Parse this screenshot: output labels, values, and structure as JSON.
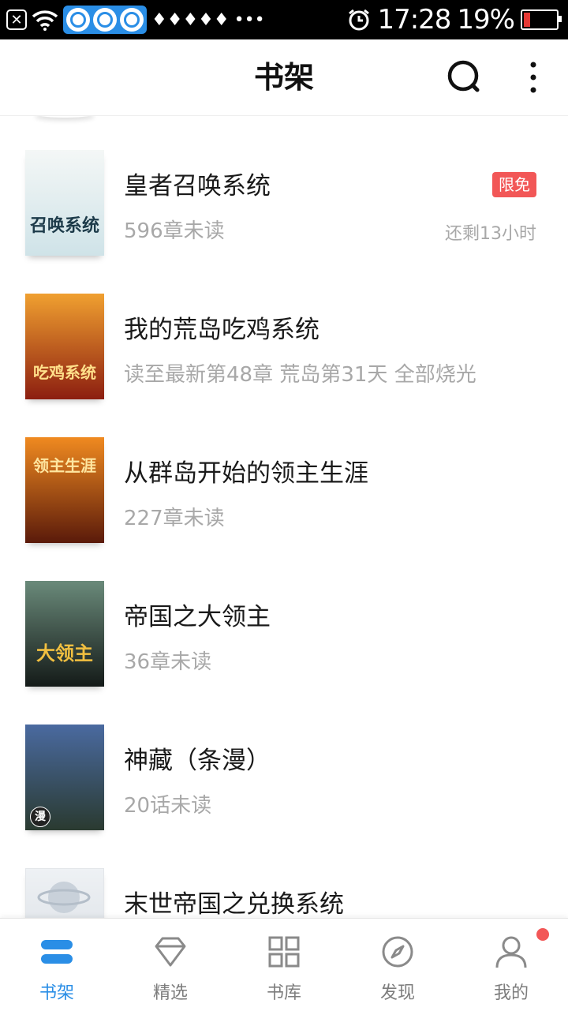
{
  "status_bar": {
    "time": "17:28",
    "battery_percent": "19%",
    "battery_level": 0.19,
    "signal_glyphs": "♦♦♦♦♦",
    "more": "•••"
  },
  "app_bar": {
    "title": "书架",
    "search_icon": "search-icon",
    "more_icon": "more-vertical-icon"
  },
  "books": [
    {
      "title": "皇者召唤系统",
      "subtitle": "596章未读",
      "badge": "限免",
      "remaining": "还剩13小时",
      "cover_text": "召唤系统",
      "cover_colors": [
        "#f4f7f6",
        "#cfe3e8"
      ],
      "cover_text_color": "#1d3b4a"
    },
    {
      "title": "我的荒岛吃鸡系统",
      "subtitle": "读至最新第48章 荒岛第31天 全部烧光",
      "cover_text": "吃鸡系统",
      "cover_colors": [
        "#f0a030",
        "#8c1e10"
      ],
      "cover_text_color": "#ffe08a"
    },
    {
      "title": "从群岛开始的领主生涯",
      "subtitle": "227章未读",
      "cover_text": "领主生涯",
      "cover_colors": [
        "#f08a20",
        "#5a1a0a"
      ],
      "cover_text_color": "#ffe6a0"
    },
    {
      "title": "帝国之大领主",
      "subtitle": "36章未读",
      "cover_text": "大领主",
      "cover_colors": [
        "#6a8a7a",
        "#141a18"
      ],
      "cover_text_color": "#f2c040"
    },
    {
      "title": "神藏（条漫）",
      "subtitle": "20话未读",
      "cover_text": "漫",
      "cover_colors": [
        "#4a6aa0",
        "#2a3a30"
      ],
      "cover_text_color": "#ffffff"
    },
    {
      "title": "末世帝国之兑换系统",
      "subtitle": "",
      "cover_text": "",
      "cover_colors": [
        "#eef1f4",
        "#d9dee4"
      ],
      "cover_text_color": "#9aa5b0"
    }
  ],
  "bottom_nav": [
    {
      "label": "书架",
      "icon": "bookshelf-icon",
      "active": true
    },
    {
      "label": "精选",
      "icon": "diamond-icon",
      "active": false
    },
    {
      "label": "书库",
      "icon": "grid-icon",
      "active": false
    },
    {
      "label": "发现",
      "icon": "compass-icon",
      "active": false
    },
    {
      "label": "我的",
      "icon": "profile-icon",
      "active": false
    }
  ],
  "colors": {
    "accent": "#2a8ee6",
    "badge_red": "#f25757",
    "muted_text": "#a8a8a8"
  }
}
